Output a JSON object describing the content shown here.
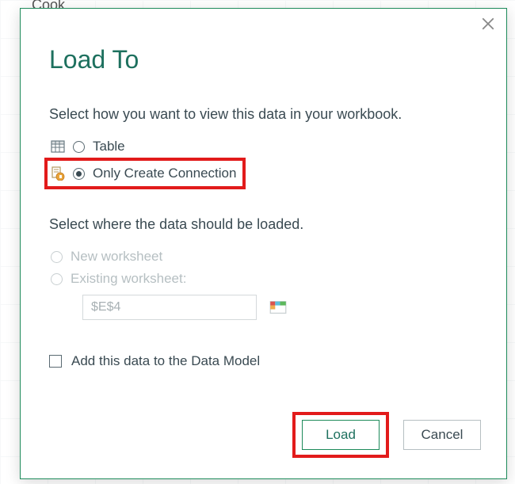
{
  "backdrop_cell": "Cook",
  "dialog": {
    "title": "Load To",
    "section1_label": "Select how you want to view this data in your workbook.",
    "options_view": {
      "table": "Table",
      "only_connection": "Only Create Connection"
    },
    "section2_label": "Select where the data should be loaded.",
    "options_where": {
      "new_ws": "New worksheet",
      "existing_ws": "Existing worksheet:"
    },
    "cell_ref": "$E$4",
    "datamodel_label": "Add this data to the Data Model",
    "buttons": {
      "load": "Load",
      "cancel": "Cancel"
    }
  }
}
